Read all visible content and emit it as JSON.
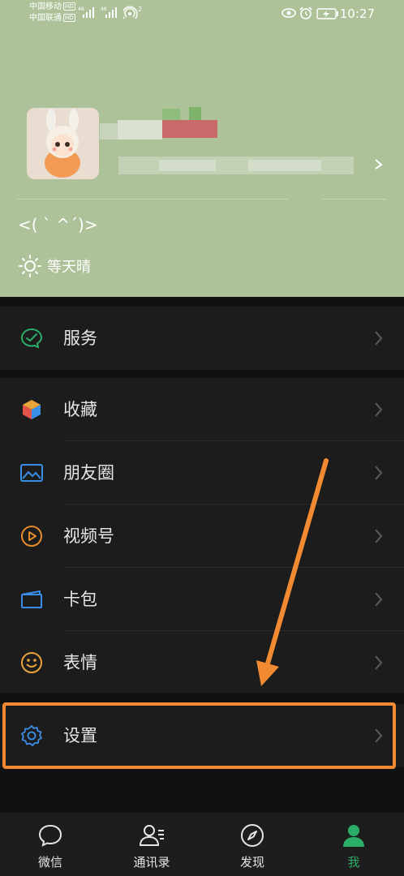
{
  "status_bar": {
    "carrier1": "中国移动",
    "carrier2": "中国联通",
    "hd_badge": "HD",
    "network1": "46",
    "network2": "46",
    "hotspot_count": "2",
    "time": "10:27"
  },
  "profile": {
    "status": "<( ˋ ^ˊ)>",
    "weather": "等天晴"
  },
  "menu": {
    "service": "服务",
    "favorites": "收藏",
    "moments": "朋友圈",
    "channels": "视频号",
    "card": "卡包",
    "emoji": "表情",
    "settings": "设置"
  },
  "tabs": {
    "chats": "微信",
    "contacts": "通讯录",
    "discover": "发现",
    "me": "我"
  },
  "colors": {
    "header_bg": "#aec29a",
    "accent_green": "#2bae67",
    "highlight_orange": "#f28a31"
  }
}
